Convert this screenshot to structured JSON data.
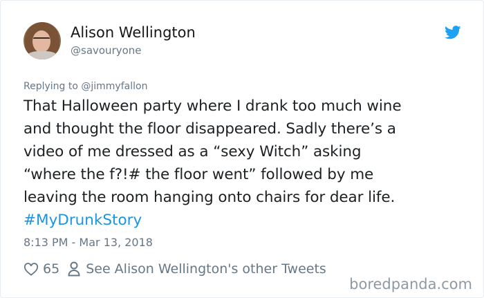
{
  "user": {
    "name": "Alison Wellington",
    "handle": "@savouryone"
  },
  "tweet": {
    "replying_to": "Replying to @jimmyfallon",
    "text": "That Halloween party where I drank too much wine\nand thought the floor disappeared. Sadly there’s a\nvideo of me dressed as a “sexy Witch” asking\n“where the f?!# the floor went” followed by me\nleaving the room hanging onto chairs for dear life.",
    "hashtag": "#MyDrunkStory",
    "timestamp": "8:13 PM - Mar 13, 2018"
  },
  "actions": {
    "likes": "65",
    "other_tweets_label": "See Alison Wellington's other Tweets"
  },
  "watermark": "boredpanda.com",
  "colors": {
    "link": "#1b95e0",
    "muted": "#657786",
    "twitter_blue": "#1da1f2"
  },
  "icons": [
    "twitter-bird-icon",
    "heart-icon",
    "person-icon"
  ]
}
